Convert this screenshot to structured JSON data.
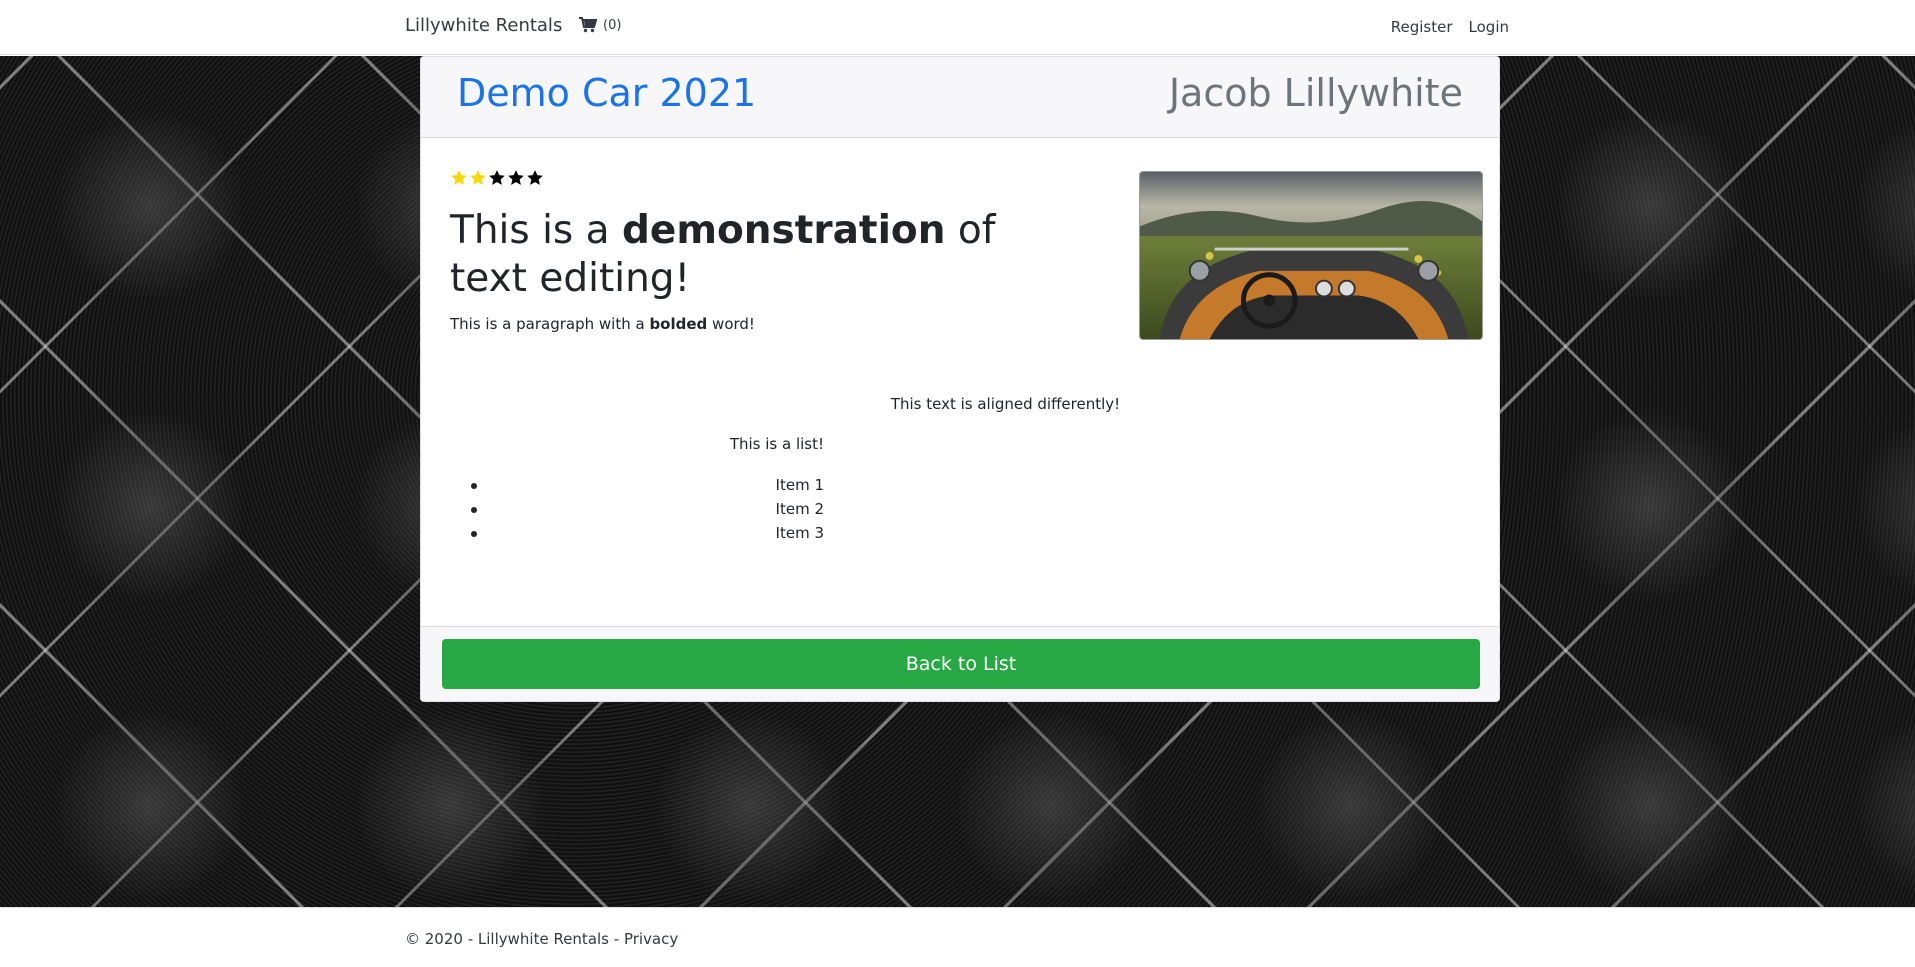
{
  "navbar": {
    "brand": "Lillywhite Rentals",
    "cart_count": "(0)",
    "register": "Register",
    "login": "Login"
  },
  "card": {
    "car_title": "Demo Car 2021",
    "owner": "Jacob Lillywhite",
    "rating": {
      "value": 2,
      "max": 5,
      "filled_color": "#f5d90a",
      "empty_color": "#000000"
    },
    "heading_pre": "This is a ",
    "heading_bold": "demonstration",
    "heading_post": " of text editing!",
    "para_pre": "This is a paragraph with a ",
    "para_bold": "bolded",
    "para_post": " word!",
    "aligned_text": "This text is aligned differently!",
    "list_intro": "This is a list!",
    "list_items": [
      "Item 1",
      "Item 2",
      "Item 3"
    ],
    "back_button": "Back to List"
  },
  "footer": {
    "copyright": "© 2020 - Lillywhite Rentals - ",
    "privacy": "Privacy"
  },
  "colors": {
    "link_blue": "#1a73e8",
    "owner_gray": "#6c757d",
    "button_green": "#28a745"
  }
}
